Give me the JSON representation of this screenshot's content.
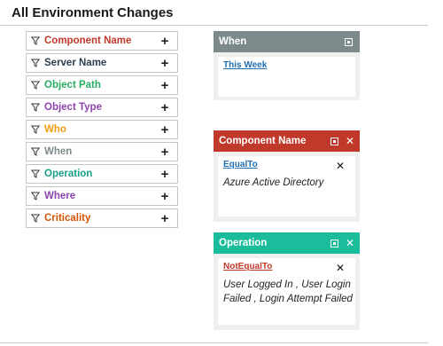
{
  "page": {
    "title": "All Environment Changes"
  },
  "colors": {
    "when_header": "#7d8a8c",
    "component_header": "#c0392b",
    "operation_header": "#1abc9c",
    "link_blue": "#1f6fb2",
    "link_red": "#c0392b"
  },
  "fields": [
    {
      "label": "Component Name",
      "color": "#c0392b",
      "icon": "funnel-icon"
    },
    {
      "label": "Server Name",
      "color": "#2c3e50",
      "icon": "funnel-icon"
    },
    {
      "label": "Object Path",
      "color": "#27ae60",
      "icon": "funnel-icon"
    },
    {
      "label": "Object Type",
      "color": "#8e44ad",
      "icon": "funnel-icon"
    },
    {
      "label": "Who",
      "color": "#f39c12",
      "icon": "funnel-icon"
    },
    {
      "label": "When",
      "color": "#7f8c8d",
      "icon": "funnel-icon"
    },
    {
      "label": "Operation",
      "color": "#16a085",
      "icon": "funnel-icon"
    },
    {
      "label": "Where",
      "color": "#8e44ad",
      "icon": "funnel-icon"
    },
    {
      "label": "Criticality",
      "color": "#d35400",
      "icon": "funnel-icon"
    }
  ],
  "add_glyph": "+",
  "panels": {
    "when": {
      "title": "When",
      "link": "This Week"
    },
    "component_name": {
      "title": "Component Name",
      "close": "✕",
      "operator": "EqualTo",
      "remove": "✕",
      "value": "Azure Active Directory"
    },
    "operation": {
      "title": "Operation",
      "close": "✕",
      "operator": "NotEqualTo",
      "remove": "✕",
      "value": "User Logged In , User Login Failed , Login Attempt Failed"
    }
  }
}
